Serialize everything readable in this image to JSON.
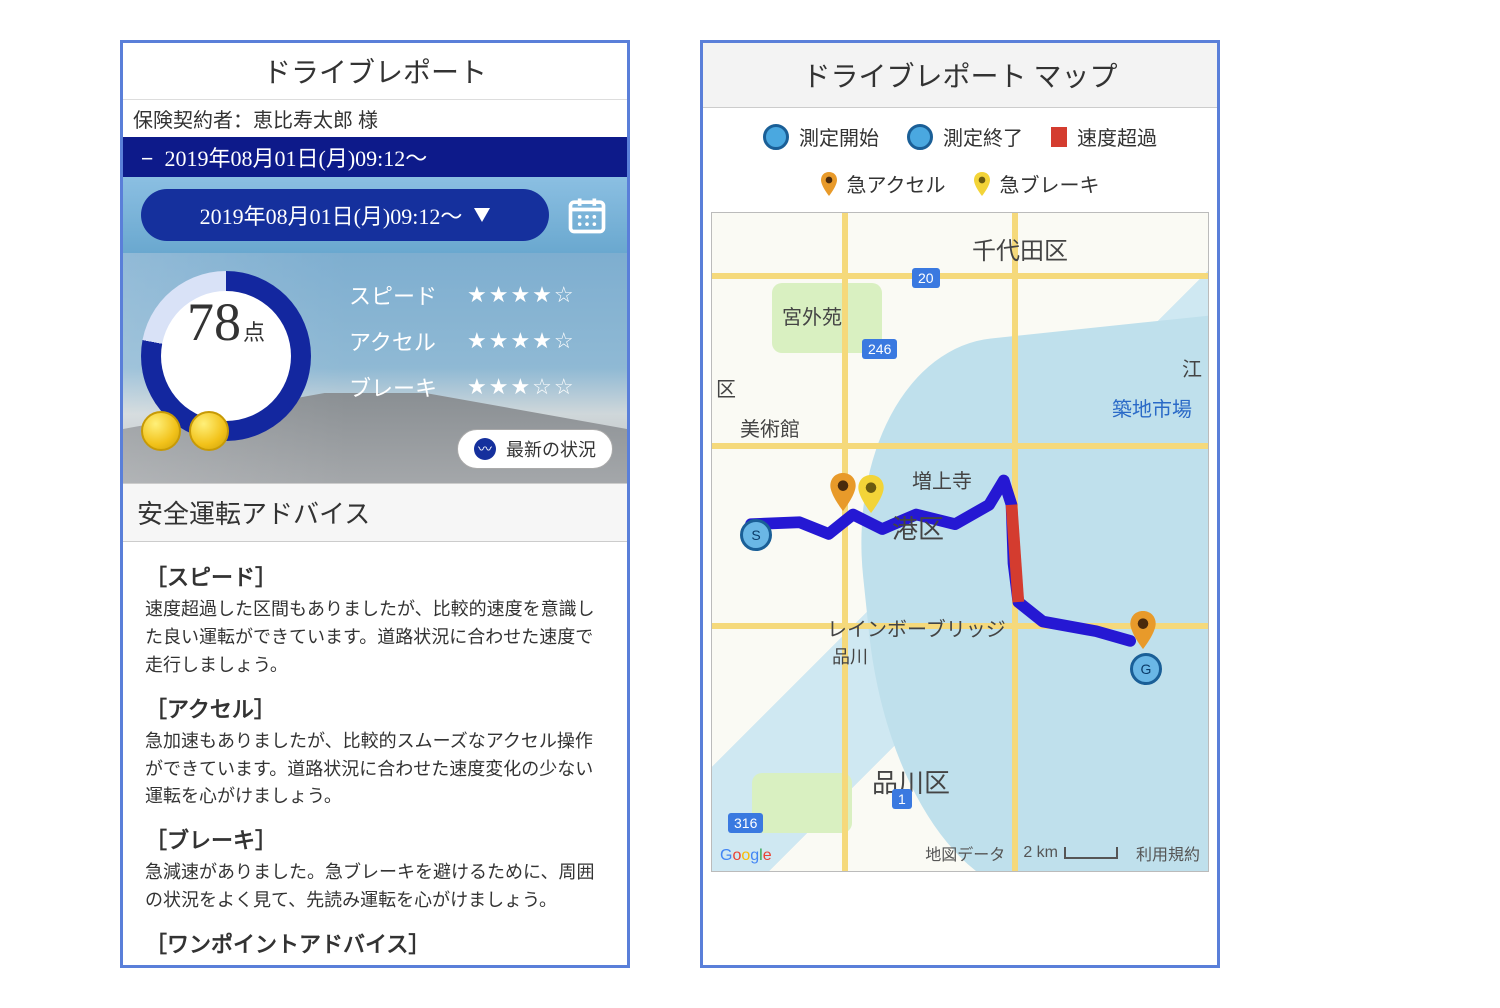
{
  "report": {
    "title": "ドライブレポート",
    "contract_label": "保険契約者：恵比寿太郎 様",
    "date_bar": "2019年08月01日(月)09:12～",
    "date_pill": "2019年08月01日(月)09:12～",
    "score_value": "78",
    "score_unit": "点",
    "metrics": {
      "speed_label": "スピード",
      "speed_stars": "★★★★☆",
      "accel_label": "アクセル",
      "accel_stars": "★★★★☆",
      "brake_label": "ブレーキ",
      "brake_stars": "★★★☆☆"
    },
    "status_button": "最新の状況",
    "advice_header": "安全運転アドバイス",
    "advice": {
      "speed_t": "［スピード］",
      "speed_b": "速度超過した区間もありましたが、比較的速度を意識した良い運転ができています。道路状況に合わせた速度で走行しましょう。",
      "accel_t": "［アクセル］",
      "accel_b": "急加速もありましたが、比較的スムーズなアクセル操作ができています。道路状況に合わせた速度変化の少ない運転を心がけましょう。",
      "brake_t": "［ブレーキ］",
      "brake_b": "急減速がありました。急ブレーキを避けるために、周囲の状況をよく見て、先読み運転を心がけましょう。",
      "tip_t": "［ワンポイントアドバイス］"
    }
  },
  "mapPanel": {
    "title": "ドライブレポート マップ",
    "legend": {
      "start": "測定開始",
      "end": "測定終了",
      "overspeed": "速度超過",
      "hard_accel": "急アクセル",
      "hard_brake": "急ブレーキ"
    },
    "labels": {
      "chiyoda": "千代田区",
      "minato": "港区",
      "shinagawa": "品川区",
      "jingu": "宮外苑",
      "tsukiji": "築地市場",
      "museum": "美術館",
      "zojoji": "増上寺",
      "rainbow": "レインボーブリッジ",
      "shinagawa2": "品川",
      "ku": "区",
      "e": "江"
    },
    "route_tags": {
      "r20": "20",
      "r246": "246",
      "r1": "1",
      "r316": "316"
    },
    "markers": {
      "start": "S",
      "end": "G"
    },
    "attribution": "Google",
    "footer_data": "地図データ",
    "scale": "2 km",
    "terms": "利用規約"
  }
}
